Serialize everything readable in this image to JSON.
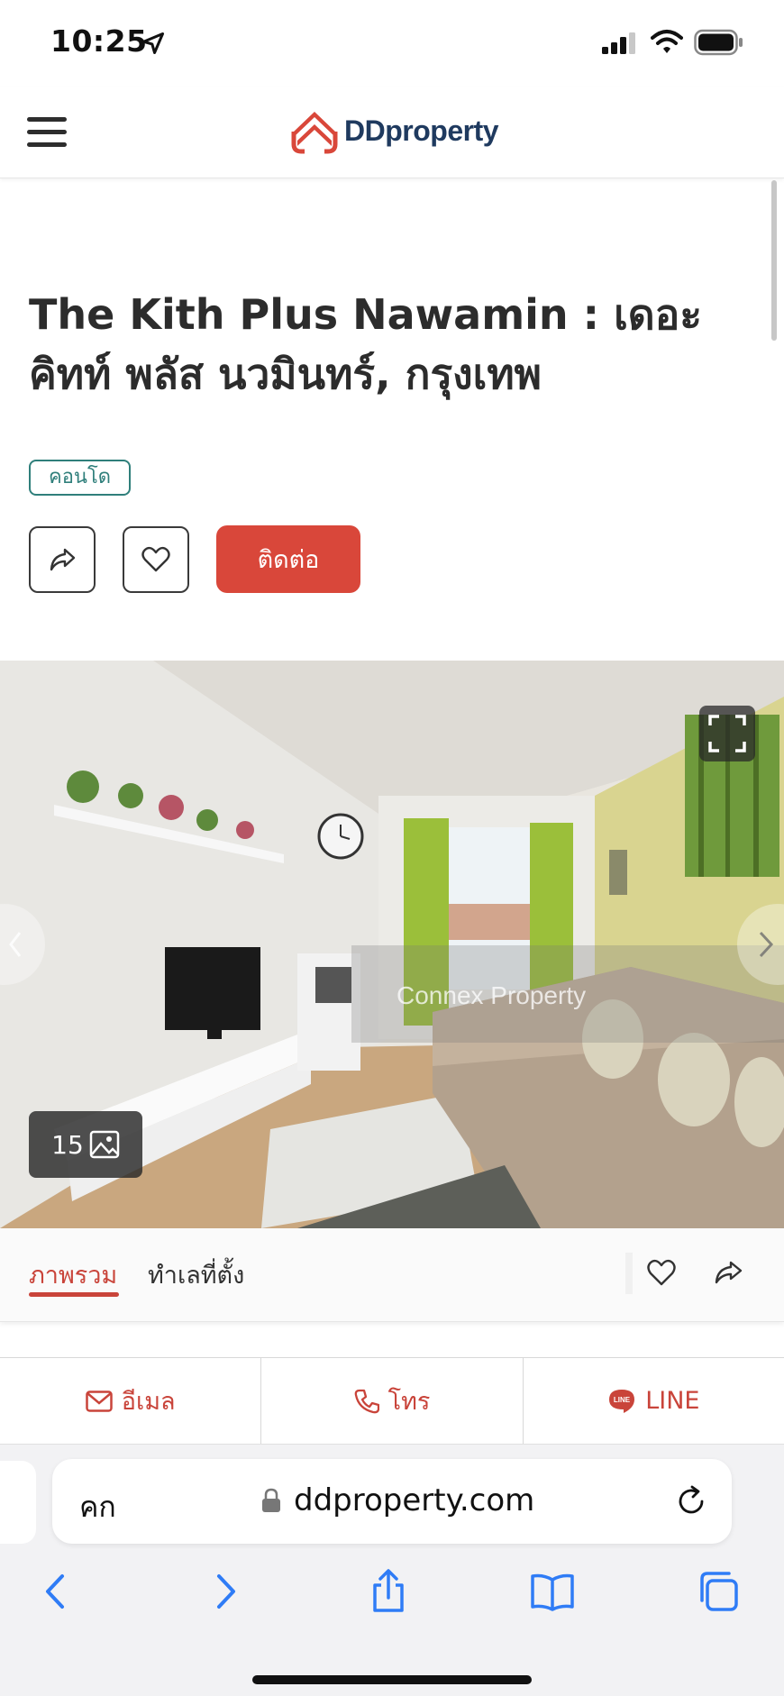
{
  "status_bar": {
    "time": "10:25"
  },
  "header": {
    "logo_text": "DDproperty",
    "icons": [
      "menu-icon",
      "ddproperty-logo"
    ]
  },
  "listing": {
    "title": "The Kith Plus Nawamin : เดอะ คิทท์ พลัส นวมินทร์, กรุงเทพ",
    "type_badge": "คอนโด",
    "contact_label": "ติดต่อ"
  },
  "gallery": {
    "watermark": "Connex Property",
    "photo_count": "15"
  },
  "tabs": {
    "overview": "ภาพรวม",
    "location": "ทำเลที่ตั้ง"
  },
  "contact_bar": {
    "email": "อีเมล",
    "phone": "โทร",
    "line": "LINE"
  },
  "browser": {
    "aa_label": "คก",
    "url": "ddproperty.com"
  },
  "colors": {
    "brand_red": "#d9473a",
    "accent_text_red": "#c9443a",
    "badge_teal": "#2f7f7b",
    "logo_navy": "#1f3a5f",
    "safari_blue": "#2f7cf6"
  }
}
